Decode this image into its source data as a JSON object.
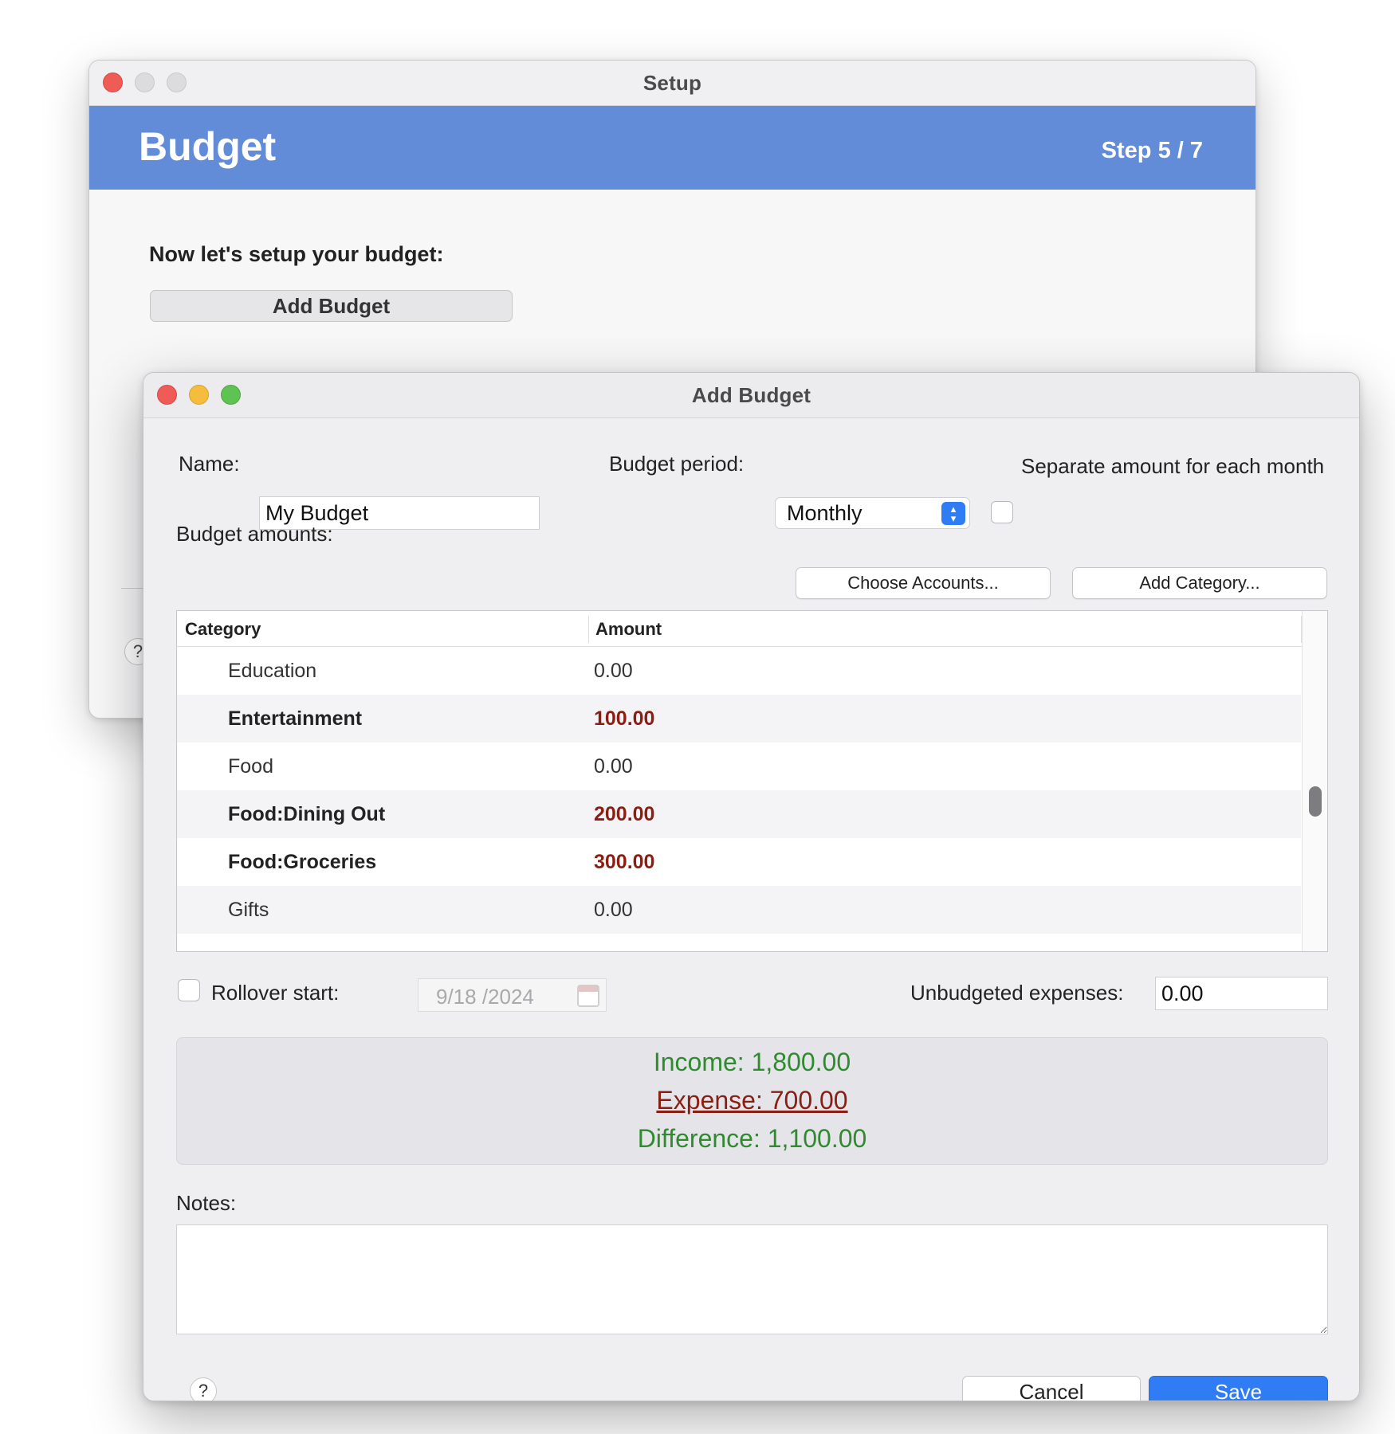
{
  "setup_window": {
    "title": "Setup",
    "header_title": "Budget",
    "step": "Step 5 / 7",
    "prompt": "Now let's setup your budget:",
    "add_budget_label": "Add Budget",
    "help": "?"
  },
  "add_budget_window": {
    "title": "Add Budget",
    "name_label": "Name:",
    "name_value": "My Budget",
    "period_label": "Budget period:",
    "period_value": "Monthly",
    "separate_label": "Separate amount for each month",
    "amounts_label": "Budget amounts:",
    "choose_accounts_label": "Choose Accounts...",
    "add_category_label": "Add Category...",
    "table": {
      "headers": {
        "category": "Category",
        "amount": "Amount"
      },
      "rows": [
        {
          "category": "Education",
          "amount": "0.00"
        },
        {
          "category": "Entertainment",
          "amount": "100.00"
        },
        {
          "category": "Food",
          "amount": "0.00"
        },
        {
          "category": "Food:Dining Out",
          "amount": "200.00"
        },
        {
          "category": "Food:Groceries",
          "amount": "300.00"
        },
        {
          "category": "Gifts",
          "amount": "0.00"
        }
      ]
    },
    "rollover_label": "Rollover start:",
    "rollover_date": "9/18 /2024",
    "unbudgeted_label": "Unbudgeted expenses:",
    "unbudgeted_value": "0.00",
    "summary": {
      "income": "Income: 1,800.00",
      "expense": "Expense: 700.00",
      "difference": "Difference: 1,100.00"
    },
    "notes_label": "Notes:",
    "help": "?",
    "cancel_label": "Cancel",
    "save_label": "Save"
  },
  "colors": {
    "header_blue": "#628bd8",
    "accent_blue": "#2f7cf4",
    "positive_green": "#2e8b2e",
    "negative_red": "#8b1e12"
  }
}
